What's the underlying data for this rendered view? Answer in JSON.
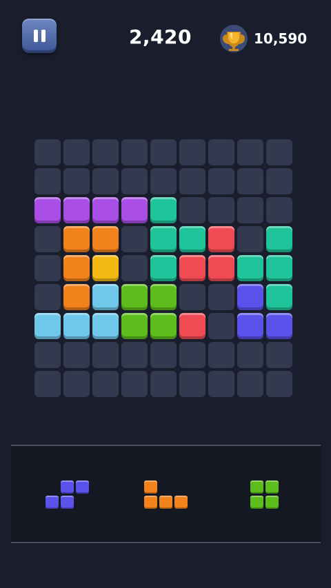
{
  "header": {
    "score": "2,420",
    "best_score": "10,590"
  },
  "icons": {
    "pause": "pause-icon",
    "trophy": "trophy-icon"
  },
  "colors": {
    "background": "#1a1e2c",
    "empty_cell": "#333a4f",
    "purple": "#a94ee6",
    "teal": "#1fc49a",
    "orange": "#f2821c",
    "yellow": "#f3b912",
    "red": "#f04b55",
    "light_blue": "#6fc7ea",
    "green": "#5cbd1d",
    "blue": "#5b52eb"
  },
  "board": {
    "rows": 9,
    "cols": 9,
    "grid": [
      [
        "",
        "",
        "",
        "",
        "",
        "",
        "",
        "",
        ""
      ],
      [
        "",
        "",
        "",
        "",
        "",
        "",
        "",
        "",
        ""
      ],
      [
        "purple",
        "purple",
        "purple",
        "purple",
        "teal",
        "",
        "",
        "",
        ""
      ],
      [
        "",
        "orange",
        "orange",
        "",
        "teal",
        "teal",
        "red",
        "",
        "teal"
      ],
      [
        "",
        "orange",
        "yellow",
        "",
        "teal",
        "red",
        "red",
        "teal",
        "teal"
      ],
      [
        "",
        "orange",
        "light_blue",
        "green",
        "green",
        "",
        "",
        "blue",
        "teal"
      ],
      [
        "light_blue",
        "light_blue",
        "light_blue",
        "green",
        "green",
        "red",
        "",
        "blue",
        "blue"
      ],
      [
        "",
        "",
        "",
        "",
        "",
        "",
        "",
        "",
        ""
      ],
      [
        "",
        "",
        "",
        "",
        "",
        "",
        "",
        "",
        ""
      ]
    ]
  },
  "tray": {
    "pieces": [
      {
        "name": "blue-s-piece",
        "color": "blue",
        "cells": [
          [
            0,
            1
          ],
          [
            0,
            2
          ],
          [
            1,
            0
          ],
          [
            1,
            1
          ]
        ]
      },
      {
        "name": "orange-j-piece",
        "color": "orange",
        "cells": [
          [
            0,
            0
          ],
          [
            1,
            0
          ],
          [
            1,
            1
          ],
          [
            1,
            2
          ]
        ]
      },
      {
        "name": "green-square-piece",
        "color": "green",
        "cells": [
          [
            0,
            0
          ],
          [
            0,
            1
          ],
          [
            1,
            0
          ],
          [
            1,
            1
          ]
        ]
      }
    ]
  }
}
